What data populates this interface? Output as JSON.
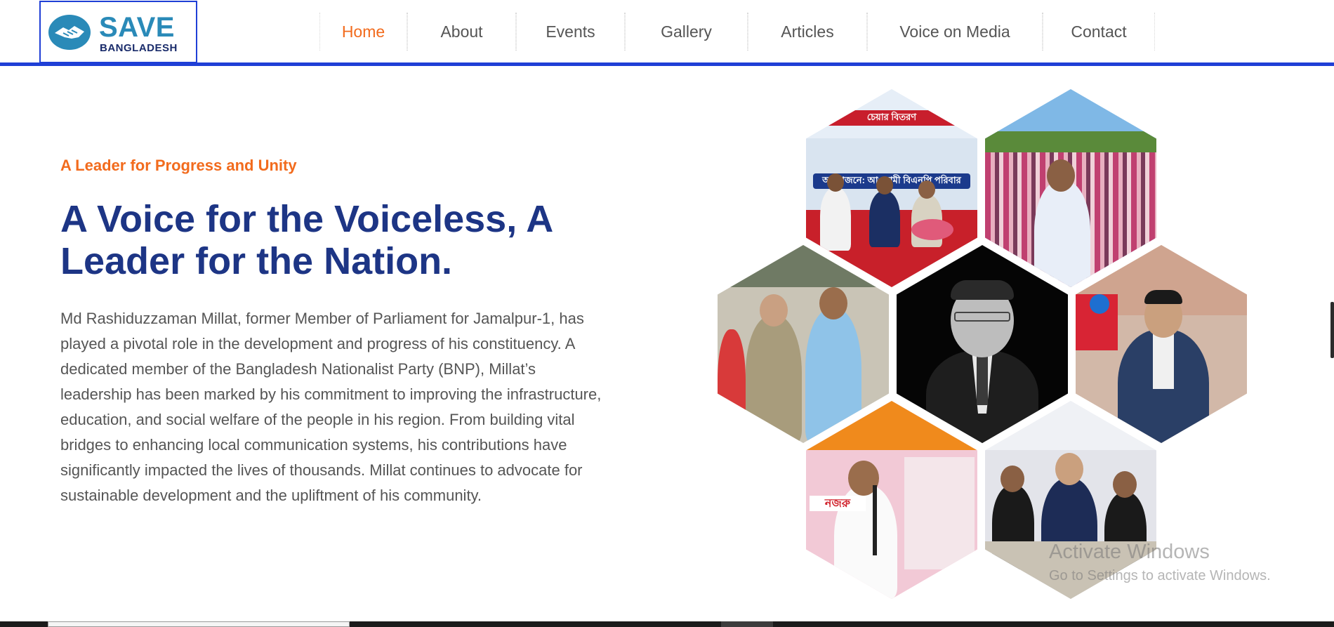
{
  "logo": {
    "title": "SAVE",
    "subtitle": "BANGLADESH",
    "icon": "handshake-icon"
  },
  "nav": {
    "items": [
      {
        "label": "Home",
        "active": true
      },
      {
        "label": "About",
        "active": false
      },
      {
        "label": "Events",
        "active": false
      },
      {
        "label": "Gallery",
        "active": false
      },
      {
        "label": "Articles",
        "active": false
      },
      {
        "label": "Voice on Media",
        "active": false
      },
      {
        "label": "Contact",
        "active": false
      }
    ]
  },
  "hero": {
    "tagline": "A Leader for Progress and Unity",
    "headline": "A Voice for the Voiceless, A Leader for the Nation.",
    "bio": "Md Rashiduzzaman Millat, former Member of Parliament for Jamalpur-1, has played a pivotal role in the development and progress of his constituency. A dedicated member of the Bangladesh Nationalist Party (BNP), Millat’s leadership has been marked by his commitment to improving the infrastructure, education, and social welfare of the people in his region. From building vital bridges to enhancing local communication systems, his contributions have significantly impacted the lives of thousands. Millat continues to advocate for sustainable development and the upliftment of his community."
  },
  "gallery": {
    "photos": [
      {
        "name": "photo-stage-event",
        "scene": "event stage with banner and seated guests"
      },
      {
        "name": "photo-rally-crowd",
        "scene": "large outdoor rally crowd"
      },
      {
        "name": "photo-street-walk",
        "scene": "walking with supporters on a street"
      },
      {
        "name": "photo-portrait",
        "scene": "black and white portrait"
      },
      {
        "name": "photo-media-studio",
        "scene": "standing in a TV studio"
      },
      {
        "name": "photo-speech",
        "scene": "giving a speech at a podium"
      },
      {
        "name": "photo-meeting",
        "scene": "speaking at a meeting"
      }
    ]
  },
  "watermark": {
    "title": "Activate Windows",
    "subtitle": "Go to Settings to activate Windows."
  },
  "colors": {
    "accent": "#f26b1d",
    "primary": "#1d3585",
    "header_border": "#1f3fd6",
    "logo_blue": "#2a8ab8"
  }
}
